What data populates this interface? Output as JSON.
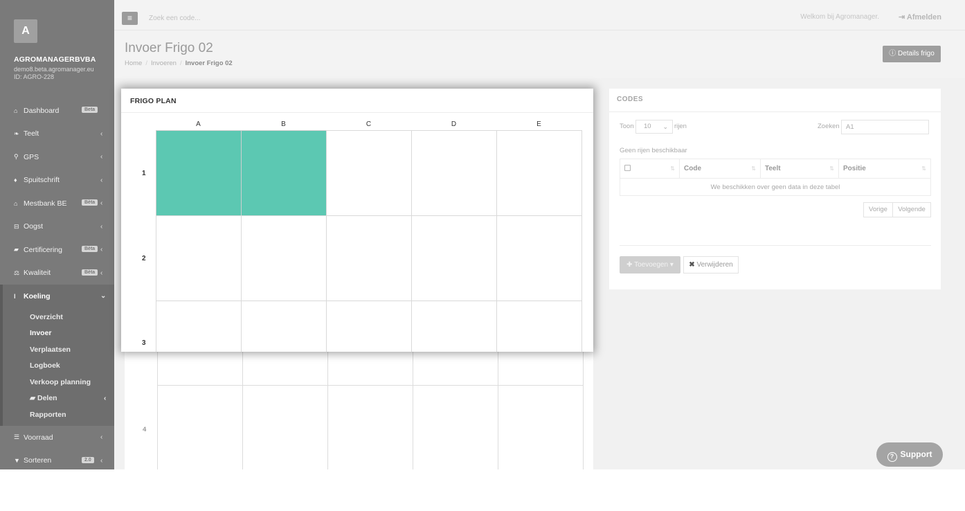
{
  "sidebar": {
    "avatar_letter": "A",
    "company": "AGROMANAGERBVBA",
    "email": "demo8.beta.agromanager.eu",
    "account_id": "ID: AGRO-228",
    "items": [
      {
        "label": "Dashboard",
        "icon": "home-icon",
        "badge": "Beta",
        "chevron": ""
      },
      {
        "label": "Teelt",
        "icon": "leaf-icon",
        "badge": "",
        "chevron": "‹"
      },
      {
        "label": "GPS",
        "icon": "map-marker-icon",
        "badge": "",
        "chevron": "‹"
      },
      {
        "label": "Spuitschrift",
        "icon": "tint-icon",
        "badge": "",
        "chevron": "‹"
      },
      {
        "label": "Mestbank BE",
        "icon": "bank-icon",
        "badge": "Bèta",
        "chevron": "‹"
      },
      {
        "label": "Oogst",
        "icon": "basket-icon",
        "badge": "",
        "chevron": "‹"
      },
      {
        "label": "Certificering",
        "icon": "book-icon",
        "badge": "Bèta",
        "chevron": "‹"
      },
      {
        "label": "Kwaliteit",
        "icon": "balance-icon",
        "badge": "Bèta",
        "chevron": "‹"
      },
      {
        "label": "Koeling",
        "icon": "thermometer-icon",
        "badge": "",
        "chevron": "⌄"
      }
    ],
    "koeling_sub": [
      "Overzicht",
      "Invoer",
      "Verplaatsen",
      "Logboek",
      "Verkoop planning",
      "Delen",
      "Rapporten"
    ],
    "bottom_items": [
      {
        "label": "Voorraad",
        "icon": "list-icon",
        "badge": "",
        "chevron": "‹"
      },
      {
        "label": "Sorteren",
        "icon": "filter-icon",
        "badge": "2.0",
        "chevron": "‹"
      }
    ]
  },
  "topbar": {
    "search_placeholder": "Zoek een code...",
    "welcome": "Welkom bij Agromanager.",
    "logout": "Afmelden"
  },
  "header": {
    "title": "Invoer Frigo 02",
    "breadcrumb": [
      "Home",
      "Invoeren",
      "Invoer Frigo 02"
    ],
    "details_button": "Details frigo"
  },
  "frigo_plan": {
    "title": "FRIGO PLAN",
    "columns": [
      "A",
      "B",
      "C",
      "D",
      "E"
    ],
    "rows": [
      "1",
      "2",
      "3"
    ],
    "background_row": "4",
    "filled_cells": [
      "1A",
      "1B"
    ],
    "filled_color": "#5cc8b2"
  },
  "codes": {
    "title": "CODES",
    "show_label": "Toon",
    "show_value": "10",
    "rows_label": "rijen",
    "search_label": "Zoeken",
    "search_value": "A1",
    "no_rows": "Geen rijen beschikbaar",
    "columns": [
      "Code",
      "Teelt",
      "Positie"
    ],
    "empty_message": "We beschikken over geen data in deze tabel",
    "prev": "Vorige",
    "next": "Volgende",
    "add_button": "Toevoegen",
    "delete_button": "Verwijderen"
  },
  "support": {
    "label": "Support"
  }
}
